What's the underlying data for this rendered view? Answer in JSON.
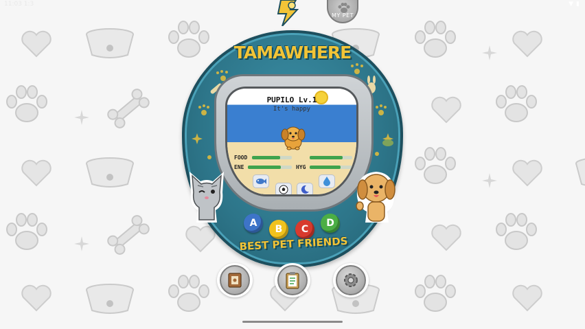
{
  "status_bar": {
    "time": "11:03 1:3",
    "signal": "▼",
    "battery": "▮"
  },
  "device": {
    "brand": "TAMAWHERE",
    "keychain_tag": "MY PET",
    "tagline": "BEST PET FRIENDS",
    "shell_color": "#2d7589",
    "accent_color": "#f2c437"
  },
  "screen": {
    "pet_name": "PUPILO Lv.1",
    "pet_status": "It's happy",
    "stats": [
      {
        "label": "FOOD",
        "level": 0.7
      },
      {
        "label": "",
        "level": 0.78
      },
      {
        "label": "ENE",
        "level": 0.75
      },
      {
        "label": "HYG",
        "level": 0.72
      }
    ],
    "actions": [
      {
        "name": "feed",
        "icon": "fish-icon"
      },
      {
        "name": "play",
        "icon": "soccer-ball-icon"
      },
      {
        "name": "sleep",
        "icon": "moon-icon"
      },
      {
        "name": "clean",
        "icon": "water-drop-icon"
      }
    ]
  },
  "buttons": [
    {
      "label": "A",
      "color": "#3d74c8"
    },
    {
      "label": "B",
      "color": "#f0c21d"
    },
    {
      "label": "C",
      "color": "#d83a2e"
    },
    {
      "label": "D",
      "color": "#4cae45"
    }
  ],
  "bottom_menu": [
    {
      "name": "pet-journal",
      "icon": "book-icon"
    },
    {
      "name": "checklist",
      "icon": "clipboard-icon"
    },
    {
      "name": "settings",
      "icon": "gear-icon"
    }
  ]
}
